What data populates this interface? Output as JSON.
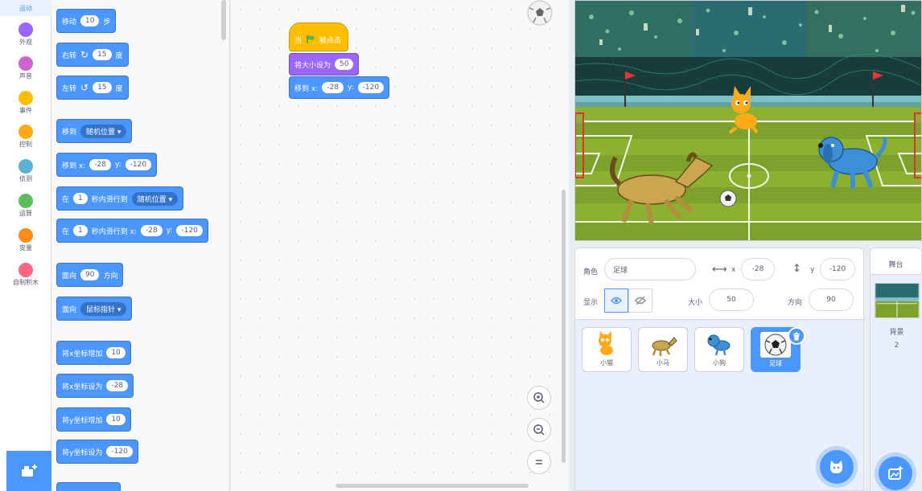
{
  "categories": [
    {
      "label": "运动",
      "color": "#4c97ff"
    },
    {
      "label": "外观",
      "color": "#9966ff"
    },
    {
      "label": "声音",
      "color": "#cf63cf"
    },
    {
      "label": "事件",
      "color": "#ffbf00"
    },
    {
      "label": "控制",
      "color": "#ffab19"
    },
    {
      "label": "侦测",
      "color": "#5cb1d6"
    },
    {
      "label": "运算",
      "color": "#59c059"
    },
    {
      "label": "变量",
      "color": "#ff8c1a"
    },
    {
      "label": "自制积木",
      "color": "#ff6680"
    }
  ],
  "palette": {
    "move": {
      "label": "移动",
      "value": "10",
      "unit": "步"
    },
    "turn_right": {
      "label": "右转",
      "value": "15",
      "unit": "度"
    },
    "turn_left": {
      "label": "左转",
      "value": "15",
      "unit": "度"
    },
    "goto": {
      "label": "移到",
      "option": "随机位置"
    },
    "goto_xy": {
      "label": "移到 x:",
      "x": "-28",
      "ylabel": "y:",
      "y": "-120"
    },
    "glide": {
      "label": "在",
      "secs": "1",
      "mid": "秒内滑行到",
      "option": "随机位置"
    },
    "glide_xy": {
      "label": "在",
      "secs": "1",
      "mid": "秒内滑行到 x:",
      "x": "-28",
      "ylabel": "y:",
      "y": "-120"
    },
    "point_dir": {
      "label": "面向",
      "value": "90",
      "unit": "方向"
    },
    "point_towards": {
      "label": "面向",
      "option": "鼠标指针"
    },
    "change_x": {
      "label": "将x坐标增加",
      "value": "10"
    },
    "set_x": {
      "label": "将x坐标设为",
      "value": "-28"
    },
    "change_y": {
      "label": "将y坐标增加",
      "value": "10"
    },
    "set_y": {
      "label": "将y坐标设为",
      "value": "-120"
    }
  },
  "script": {
    "hat_left": "当",
    "hat_right": "被点击",
    "size_label": "将大小设为",
    "size_value": "50",
    "goto_label": "移到 x:",
    "goto_x": "-28",
    "goto_ylabel": "y:",
    "goto_y": "-120"
  },
  "sprite_info": {
    "sprite_label": "角色",
    "sprite_name": "足球",
    "x_label": "x",
    "x_value": "-28",
    "y_label": "y",
    "y_value": "-120",
    "show_label": "显示",
    "size_label": "大小",
    "size_value": "50",
    "direction_label": "方向",
    "direction_value": "90"
  },
  "sprites": [
    {
      "name": "小猫",
      "selected": false
    },
    {
      "name": "小马",
      "selected": false
    },
    {
      "name": "小狗",
      "selected": false
    },
    {
      "name": "足球",
      "selected": true
    }
  ],
  "stage_panel": {
    "title": "舞台",
    "backdrop_label": "背景",
    "backdrop_count": "2"
  },
  "colors": {
    "motion": "#4c97ff",
    "looks": "#9966ff",
    "events": "#ffbf00",
    "selected": "#4c97ff"
  }
}
